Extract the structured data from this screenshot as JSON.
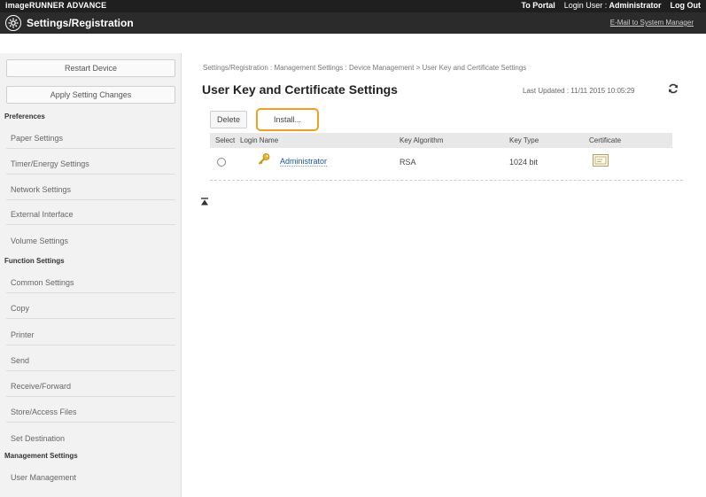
{
  "topbar": {
    "brand": "imageRUNNER ADVANCE",
    "device_name": "",
    "to_portal": "To Portal",
    "login_user_label": "Login User :",
    "login_user_value": "Administrator",
    "logout": "Log Out"
  },
  "header": {
    "title": "Settings/Registration",
    "email_link": "E-Mail to System Manager"
  },
  "sidebar": {
    "restart_button": "Restart Device",
    "apply_button": "Apply Setting Changes",
    "preferences_heading": "Preferences",
    "preferences_items": [
      "Paper Settings",
      "Timer/Energy Settings",
      "Network Settings",
      "External Interface",
      "Volume Settings"
    ],
    "function_heading": "Function Settings",
    "function_items": [
      "Common Settings",
      "Copy",
      "Printer",
      "Send",
      "Receive/Forward",
      "Store/Access Files",
      "Set Destination"
    ],
    "management_heading": "Management Settings",
    "management_items": [
      "User Management"
    ]
  },
  "main": {
    "breadcrumb": "Settings/Registration : Management Settings : Device Management > User Key and Certificate Settings",
    "title": "User Key and Certificate Settings",
    "last_updated": "Last Updated : 11/11 2015 10:05:29",
    "delete_button": "Delete",
    "install_button": "Install...",
    "columns": [
      "Select",
      "Login Name",
      "Key Algorithm",
      "Key Type",
      "Certificate"
    ],
    "row": {
      "login_name": "Administrator",
      "key_algorithm": "RSA",
      "key_type": "1024 bit"
    }
  },
  "colors": {
    "topbar_bg": "#1f1f1f",
    "highlight": "#f2a01e",
    "link": "#1b55a6"
  }
}
